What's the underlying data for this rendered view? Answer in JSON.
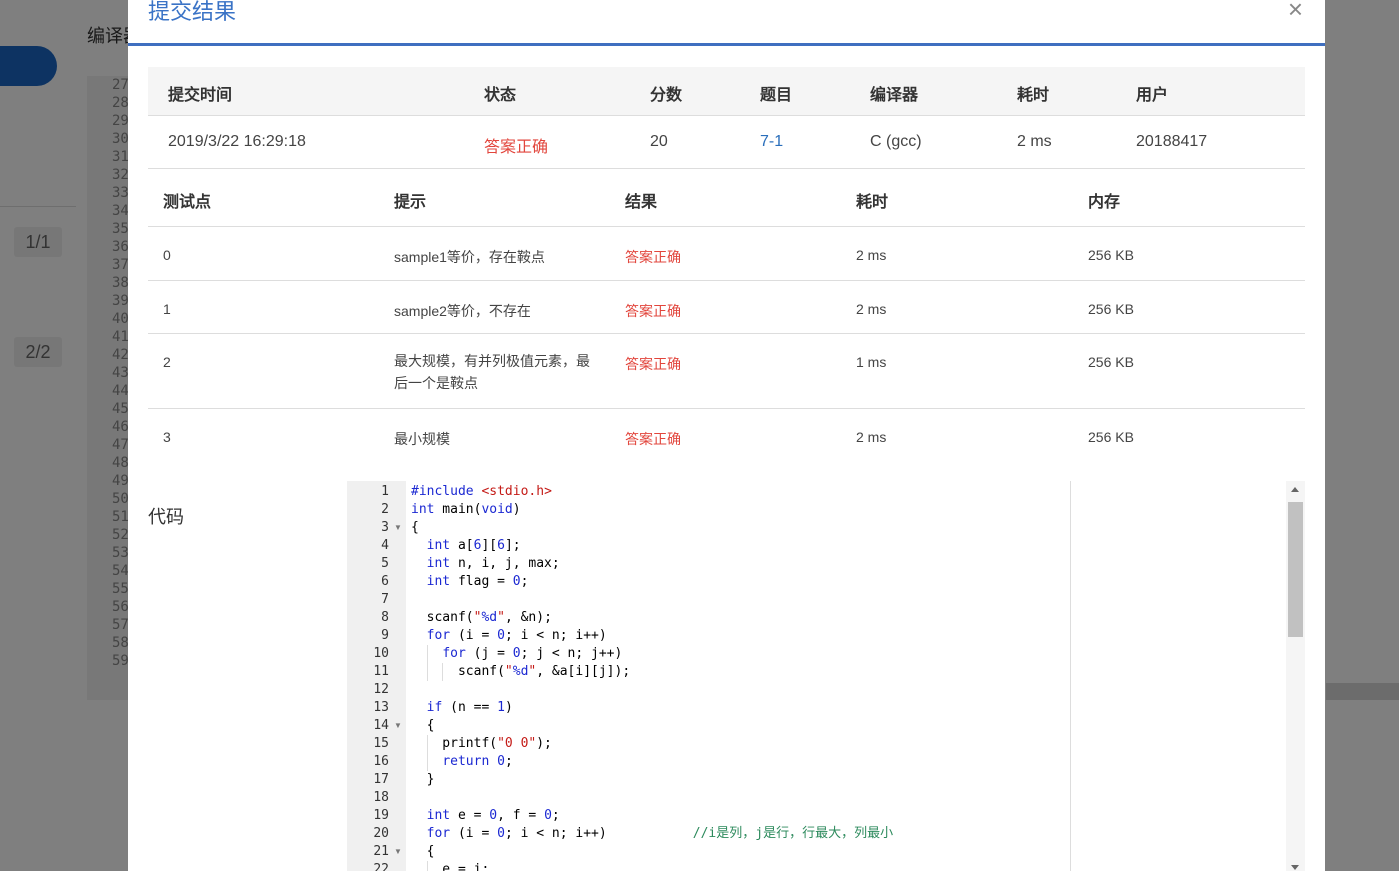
{
  "background": {
    "compiler_label": "编译器",
    "pages": [
      "1/1",
      "2/2"
    ],
    "line_numbers": [
      "27",
      "28",
      "29",
      "30",
      "31",
      "32",
      "33",
      "34",
      "35",
      "36",
      "37",
      "38",
      "39",
      "40",
      "41",
      "42",
      "43",
      "44",
      "45",
      "46",
      "47",
      "48",
      "49",
      "50",
      "51",
      "52",
      "53",
      "54",
      "55",
      "56",
      "57",
      "58",
      "59"
    ]
  },
  "modal": {
    "title": "提交结果",
    "close_glyph": "×"
  },
  "submission": {
    "headers": {
      "time": "提交时间",
      "status": "状态",
      "score": "分数",
      "problem": "题目",
      "compiler": "编译器",
      "duration": "耗时",
      "user": "用户"
    },
    "row": {
      "time": "2019/3/22 16:29:18",
      "status": "答案正确",
      "score": "20",
      "problem": "7-1",
      "compiler": "C (gcc)",
      "duration": "2 ms",
      "user": "20188417"
    }
  },
  "tests": {
    "headers": {
      "case": "测试点",
      "hint": "提示",
      "result": "结果",
      "duration": "耗时",
      "memory": "内存"
    },
    "rows": [
      {
        "case": "0",
        "hint": "sample1等价，存在鞍点",
        "result": "答案正确",
        "duration": "2 ms",
        "memory": "256 KB"
      },
      {
        "case": "1",
        "hint": "sample2等价，不存在",
        "result": "答案正确",
        "duration": "2 ms",
        "memory": "256 KB"
      },
      {
        "case": "2",
        "hint": "最大规模，有并列极值元素，最后一个是鞍点",
        "result": "答案正确",
        "duration": "1 ms",
        "memory": "256 KB"
      },
      {
        "case": "3",
        "hint": "最小规模",
        "result": "答案正确",
        "duration": "2 ms",
        "memory": "256 KB"
      }
    ]
  },
  "code": {
    "label": "代码",
    "lines": [
      "#include <stdio.h>",
      "int main(void)",
      "{",
      "  int a[6][6];",
      "  int n, i, j, max;",
      "  int flag = 0;",
      "",
      "  scanf(\"%d\", &n);",
      "  for (i = 0; i < n; i++)",
      "    for (j = 0; j < n; j++)",
      "      scanf(\"%d\", &a[i][j]);",
      "",
      "  if (n == 1)",
      "  {",
      "    printf(\"0 0\");",
      "    return 0;",
      "  }",
      "",
      "  int e = 0, f = 0;",
      "  for (i = 0; i < n; i++)           //i是列，j是行，行最大，列最小",
      "  {",
      "    e = i;"
    ],
    "fold_lines": [
      3,
      14,
      21
    ],
    "fold_glyph": "▼"
  }
}
